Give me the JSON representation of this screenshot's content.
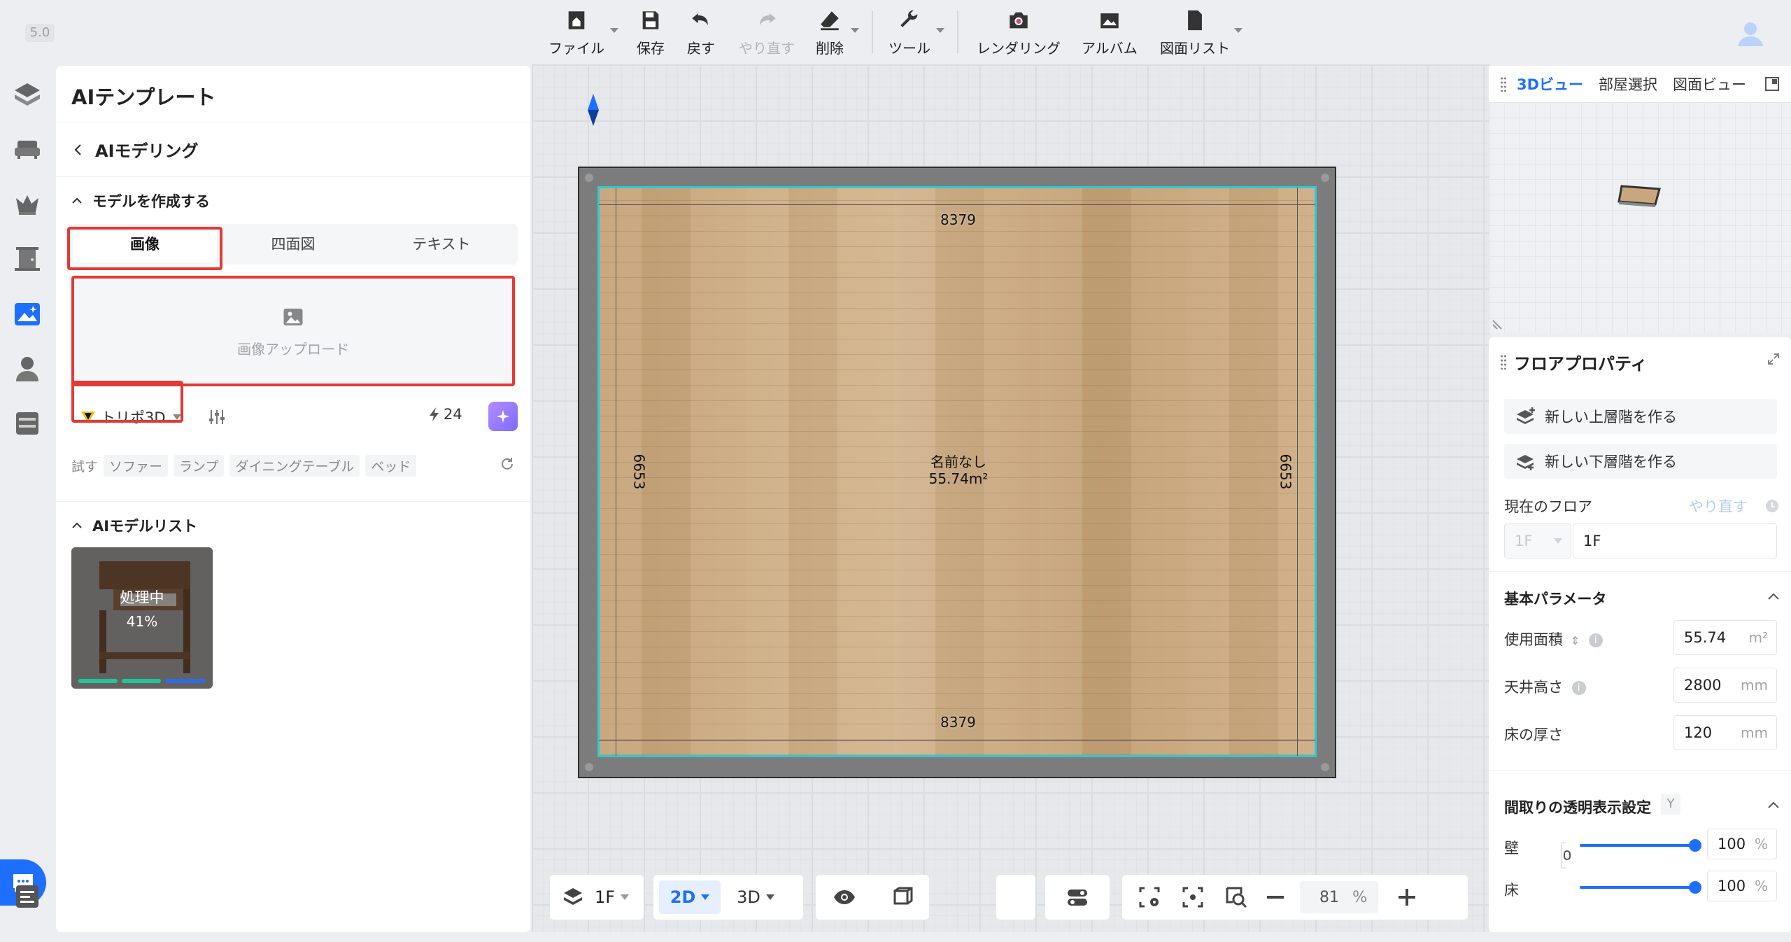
{
  "version": "5.0",
  "toolbar": {
    "file": "ファイル",
    "save": "保存",
    "undo": "戻す",
    "redo": "やり直す",
    "delete": "削除",
    "tools": "ツール",
    "render": "レンダリング",
    "album": "アルバム",
    "drawings": "図面リスト"
  },
  "left_panel": {
    "title": "AIテンプレート",
    "back_label": "AIモデリング",
    "create_section": "モデルを作成する",
    "tabs": [
      "画像",
      "四面図",
      "テキスト"
    ],
    "upload_label": "画像アップロード",
    "model_name": "トリポ3D",
    "credits": "24",
    "try_label": "試す",
    "try_chips": [
      "ソファー",
      "ランプ",
      "ダイニングテーブル",
      "ベッド"
    ],
    "model_list_section": "AIモデルリスト",
    "model_status": "処理中",
    "model_progress": "41%"
  },
  "canvas": {
    "dim_top": "8379",
    "dim_bottom": "8379",
    "dim_left": "6653",
    "dim_right": "6653",
    "room_name": "名前なし",
    "room_area": "55.74m²"
  },
  "bottom_toolbar": {
    "floor": "1F",
    "view2d": "2D",
    "view3d": "3D",
    "zoom": "81",
    "zoom_unit": "%"
  },
  "view_panel": {
    "tabs": [
      "3Dビュー",
      "部屋選択",
      "図面ビュー"
    ]
  },
  "floor_props": {
    "title": "フロアプロパティ",
    "new_upper": "新しい上層階を作る",
    "new_lower": "新しい下層階を作る",
    "current_floor_label": "現在のフロア",
    "redo_label": "やり直す",
    "floor_prefix": "1F",
    "floor_value": "1F",
    "basic_params": "基本パラメータ",
    "area_label": "使用面積",
    "area_value": "55.74",
    "area_unit": "m²",
    "ceiling_label": "天井高さ",
    "ceiling_value": "2800",
    "ceiling_unit": "mm",
    "floor_thick_label": "床の厚さ",
    "floor_thick_value": "120",
    "floor_thick_unit": "mm",
    "transparency_label": "間取りの透明表示設定",
    "transparency_key": "Y",
    "wall_label": "壁",
    "wall_value": "100",
    "floor_label": "床",
    "floor_t_value": "100",
    "pct": "%"
  },
  "colors": {
    "accent": "#1e6fff",
    "highlight": "#e53935",
    "room_outline": "#2ec9d6"
  }
}
